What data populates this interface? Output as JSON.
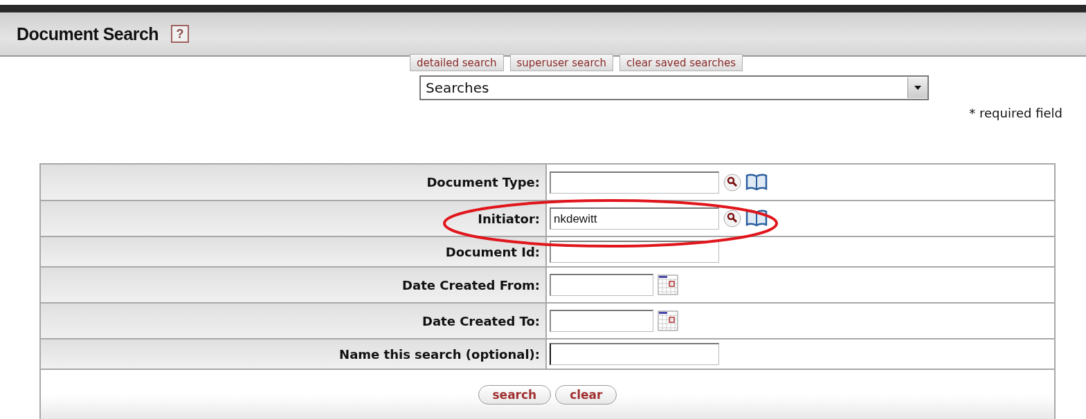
{
  "header": {
    "title": "Document Search",
    "help": "?"
  },
  "tabs": [
    {
      "label": "detailed search"
    },
    {
      "label": "superuser search"
    },
    {
      "label": "clear saved searches"
    }
  ],
  "saved_searches": {
    "value": "Searches"
  },
  "required_note": "* required field",
  "fields": [
    {
      "label": "Document Type:",
      "kind": "lookup"
    },
    {
      "label": "Initiator:",
      "kind": "lookup",
      "value": "nkdewitt"
    },
    {
      "label": "Document Id:",
      "kind": "text"
    },
    {
      "label": "Date Created From:",
      "kind": "date"
    },
    {
      "label": "Date Created To:",
      "kind": "date"
    },
    {
      "label": "Name this search (optional):",
      "kind": "name"
    }
  ],
  "actions": [
    {
      "label": "search"
    },
    {
      "label": "clear"
    }
  ],
  "annotation": {
    "kind": "ellipse",
    "color": "#e0161c"
  }
}
